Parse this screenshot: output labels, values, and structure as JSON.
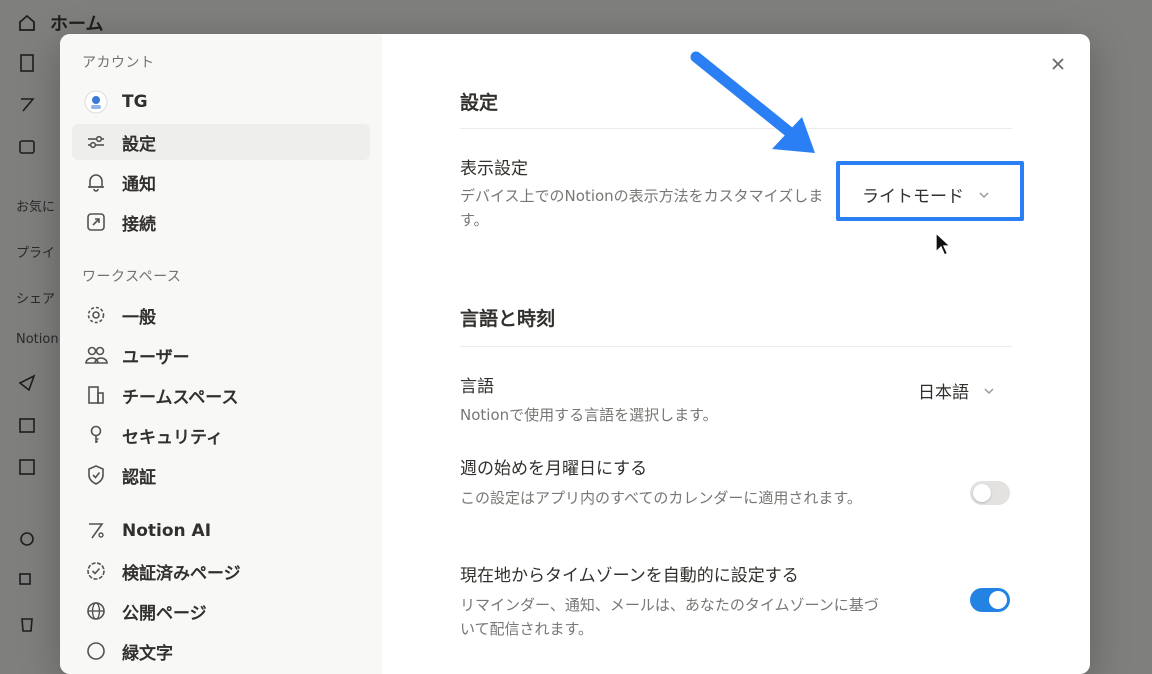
{
  "background": {
    "home_label": "ホーム",
    "sections": [
      "お気に",
      "プライ",
      "シェア",
      "Notion"
    ]
  },
  "modal": {
    "account_section": "アカウント",
    "account_items": [
      {
        "label": "TG",
        "icon": "avatar-icon"
      },
      {
        "label": "設定",
        "icon": "sliders-icon"
      },
      {
        "label": "通知",
        "icon": "bell-icon"
      },
      {
        "label": "接続",
        "icon": "external-link-icon"
      }
    ],
    "workspace_section": "ワークスペース",
    "workspace_items": [
      {
        "label": "一般",
        "icon": "gear-icon"
      },
      {
        "label": "ユーザー",
        "icon": "users-icon"
      },
      {
        "label": "チームスペース",
        "icon": "building-icon"
      },
      {
        "label": "セキュリティ",
        "icon": "key-icon"
      },
      {
        "label": "認証",
        "icon": "shield-check-icon"
      }
    ],
    "extra_items": [
      {
        "label": "Notion AI",
        "icon": "notion-ai-icon"
      },
      {
        "label": "検証済みページ",
        "icon": "verified-icon"
      },
      {
        "label": "公開ページ",
        "icon": "globe-icon"
      },
      {
        "label": "緑文字",
        "icon": "circle-icon"
      }
    ]
  },
  "settings": {
    "section_title": "設定",
    "display": {
      "title": "表示設定",
      "description": "デバイス上でのNotionの表示方法をカスタマイズします。",
      "value": "ライトモード"
    },
    "language_section_title": "言語と時刻",
    "language": {
      "title": "言語",
      "description": "Notionで使用する言語を選択します。",
      "value": "日本語"
    },
    "week_start": {
      "title": "週の始めを月曜日にする",
      "description": "この設定はアプリ内のすべてのカレンダーに適用されます。",
      "enabled": false
    },
    "timezone": {
      "title": "現在地からタイムゾーンを自動的に設定する",
      "description": "リマインダー、通知、メールは、あなたのタイムゾーンに基づいて配信されます。",
      "enabled": true
    }
  },
  "colors": {
    "highlight": "#2a7ff4",
    "toggle_on": "#2383e2"
  }
}
